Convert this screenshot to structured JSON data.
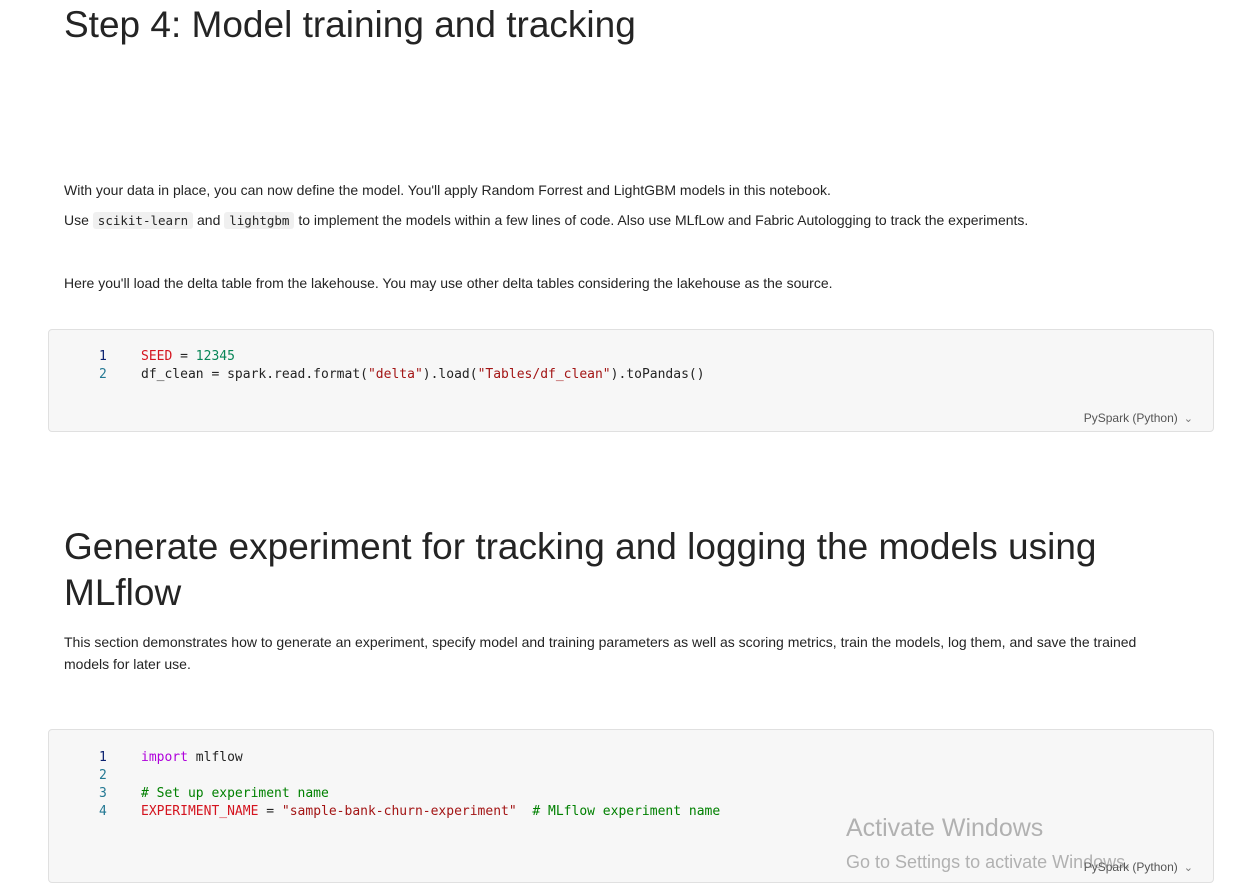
{
  "section1": {
    "heading": "Step 4: Model training and tracking",
    "para1": "With your data in place, you can now define the model. You'll apply Random Forrest and LightGBM models in this notebook.",
    "para2_before": "Use ",
    "para2_code1": "scikit-learn",
    "para2_mid": " and ",
    "para2_code2": "lightgbm",
    "para2_after": " to implement the models within a few lines of code. Also use MLfLow and Fabric Autologging to track the experiments.",
    "para3": "Here you'll load the delta table from the lakehouse. You may use other delta tables considering the lakehouse as the source."
  },
  "cell1": {
    "lines": [
      {
        "n": "1",
        "var": "SEED",
        "op": " = ",
        "num": "12345"
      },
      {
        "n": "2",
        "a": "df_clean = spark.read.format(",
        "s1": "\"delta\"",
        "b": ").load(",
        "s2": "\"Tables/df_clean\"",
        "c": ").toPandas()"
      }
    ],
    "language": "PySpark (Python)"
  },
  "section2": {
    "heading": "Generate experiment for tracking and logging the models using MLflow",
    "para1": "This section demonstrates how to generate an experiment, specify model and training parameters as well as scoring metrics, train the models, log them, and save the trained models for later use."
  },
  "cell2": {
    "lines": [
      {
        "n": "1",
        "kw": "import",
        "rest": " mlflow"
      },
      {
        "n": "2"
      },
      {
        "n": "3",
        "comment": "# Set up experiment name"
      },
      {
        "n": "4",
        "var": "EXPERIMENT_NAME",
        "op": " = ",
        "str": "\"sample-bank-churn-experiment\"",
        "comment": "  # MLflow experiment name"
      }
    ],
    "language": "PySpark (Python)"
  },
  "watermark": {
    "title": "Activate Windows",
    "subtitle": "Go to Settings to activate Windows."
  }
}
